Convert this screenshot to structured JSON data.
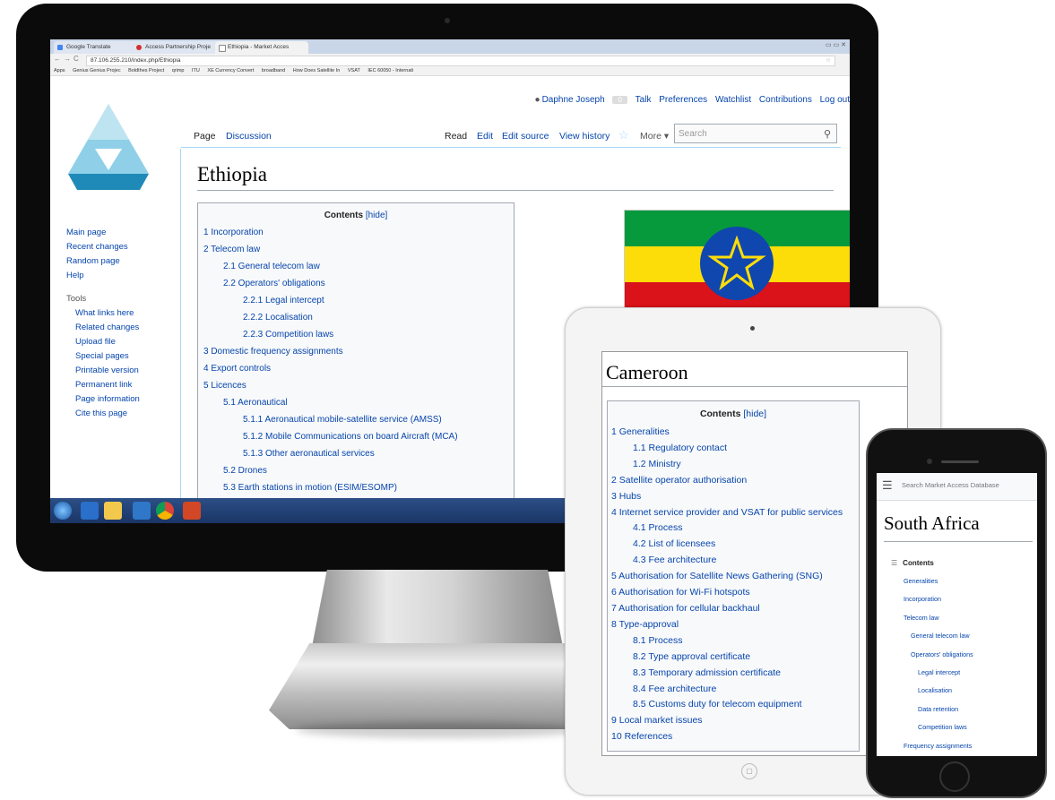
{
  "desktop": {
    "browser": {
      "tabs": [
        "Google Translate",
        "Access Partnership Proje",
        "Ethiopia - Market Acces"
      ],
      "url": "87.106.255.210/index.php/Ethiopia",
      "bookmarks": [
        "Apps",
        "Genius Genius Projec",
        "Boldthes Project",
        "qrimp",
        "ITU",
        "XE Currency Convert",
        "broadband",
        "How Does Satellite In",
        "VSAT",
        "IEC 60050 - Internati"
      ]
    },
    "user_bar": {
      "username": "Daphne Joseph",
      "notifications": "0",
      "links": [
        "Talk",
        "Preferences",
        "Watchlist",
        "Contributions",
        "Log out"
      ]
    },
    "page_tabs": {
      "page": "Page",
      "discussion": "Discussion",
      "read": "Read",
      "edit": "Edit",
      "edit_source": "Edit source",
      "view_history": "View history",
      "more": "More ▾"
    },
    "search_placeholder": "Search",
    "title": "Ethiopia",
    "sidebar": {
      "nav": [
        "Main page",
        "Recent changes",
        "Random page",
        "Help"
      ],
      "tools_heading": "Tools",
      "tools": [
        "What links here",
        "Related changes",
        "Upload file",
        "Special pages",
        "Printable version",
        "Permanent link",
        "Page information",
        "Cite this page"
      ]
    },
    "toc": {
      "heading": "Contents",
      "hide": "[hide]",
      "items": [
        {
          "text": "1 Incorporation",
          "level": 1
        },
        {
          "text": "2 Telecom law",
          "level": 1
        },
        {
          "text": "2.1 General telecom law",
          "level": 2
        },
        {
          "text": "2.2 Operators' obligations",
          "level": 2
        },
        {
          "text": "2.2.1 Legal intercept",
          "level": 3
        },
        {
          "text": "2.2.2 Localisation",
          "level": 3
        },
        {
          "text": "2.2.3 Competition laws",
          "level": 3
        },
        {
          "text": "3 Domestic frequency assignments",
          "level": 1
        },
        {
          "text": "4 Export controls",
          "level": 1
        },
        {
          "text": "5 Licences",
          "level": 1
        },
        {
          "text": "5.1 Aeronautical",
          "level": 2
        },
        {
          "text": "5.1.1 Aeronautical mobile-satellite service (AMSS)",
          "level": 3
        },
        {
          "text": "5.1.2 Mobile Communications on board Aircraft (MCA)",
          "level": 3
        },
        {
          "text": "5.1.3 Other aeronautical services",
          "level": 3
        },
        {
          "text": "5.2 Drones",
          "level": 2
        },
        {
          "text": "5.3 Earth stations in motion (ESIM/ESOMP)",
          "level": 2
        }
      ]
    }
  },
  "tablet": {
    "title": "Cameroon",
    "toc": {
      "heading": "Contents",
      "hide": "[hide]",
      "items": [
        {
          "text": "1  Generalities",
          "level": 1
        },
        {
          "text": "1.1  Regulatory contact",
          "level": 2
        },
        {
          "text": "1.2  Ministry",
          "level": 2
        },
        {
          "text": "2  Satellite operator authorisation",
          "level": 1
        },
        {
          "text": "3  Hubs",
          "level": 1
        },
        {
          "text": "4  Internet service provider and VSAT for public services",
          "level": 1
        },
        {
          "text": "4.1  Process",
          "level": 2
        },
        {
          "text": "4.2  List of licensees",
          "level": 2
        },
        {
          "text": "4.3  Fee architecture",
          "level": 2
        },
        {
          "text": "5  Authorisation for Satellite News Gathering (SNG)",
          "level": 1
        },
        {
          "text": "6  Authorisation for Wi-Fi hotspots",
          "level": 1
        },
        {
          "text": "7  Authorisation for cellular backhaul",
          "level": 1
        },
        {
          "text": "8  Type-approval",
          "level": 1
        },
        {
          "text": "8.1  Process",
          "level": 2
        },
        {
          "text": "8.2  Type approval certificate",
          "level": 2
        },
        {
          "text": "8.3  Temporary admission certificate",
          "level": 2
        },
        {
          "text": "8.4  Fee architecture",
          "level": 2
        },
        {
          "text": "8.5  Customs duty for telecom equipment",
          "level": 2
        },
        {
          "text": "9  Local market issues",
          "level": 1
        },
        {
          "text": "10  References",
          "level": 1
        }
      ]
    }
  },
  "phone": {
    "search_placeholder": "Search Market Access Database",
    "title": "South Africa",
    "toc": {
      "heading": "Contents",
      "items": [
        {
          "text": "Generalities",
          "level": 1
        },
        {
          "text": "Incorporation",
          "level": 1
        },
        {
          "text": "Telecom law",
          "level": 1
        },
        {
          "text": "General telecom law",
          "level": 2
        },
        {
          "text": "Operators' obligations",
          "level": 2
        },
        {
          "text": "Legal intercept",
          "level": 3
        },
        {
          "text": "Localisation",
          "level": 3
        },
        {
          "text": "Data retention",
          "level": 3
        },
        {
          "text": "Competition laws",
          "level": 3
        },
        {
          "text": "Frequency assignments",
          "level": 1
        }
      ]
    }
  },
  "colors": {
    "link": "#0645ad",
    "flag_green": "#079a3d",
    "flag_yellow": "#fcdd09",
    "flag_red": "#da121a",
    "flag_blue": "#0f47af"
  }
}
